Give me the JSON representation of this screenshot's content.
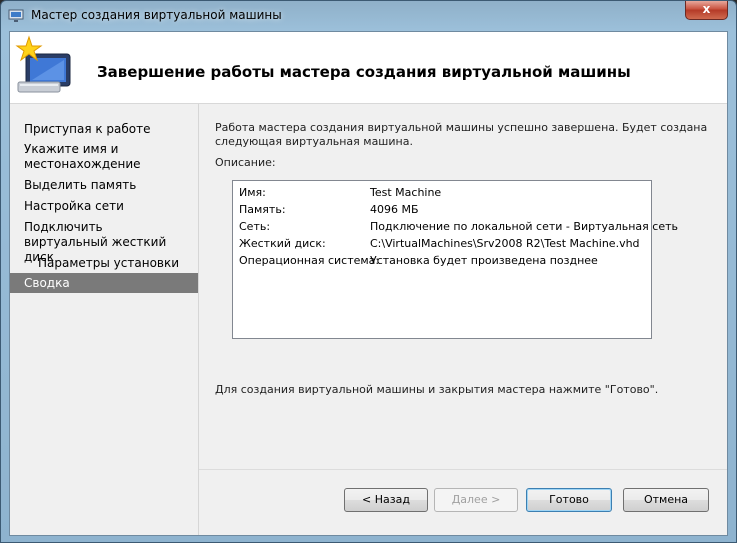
{
  "window": {
    "title": "Мастер создания виртуальной машины",
    "close_glyph": "x"
  },
  "header": {
    "title": "Завершение работы мастера создания виртуальной машины",
    "icon": "wizard-monitor-star-icon"
  },
  "nav": {
    "items": [
      {
        "label": "Приступая к работе"
      },
      {
        "label": "Укажите имя и местонахождение"
      },
      {
        "label": "Выделить память"
      },
      {
        "label": "Настройка сети"
      },
      {
        "label": "Подключить виртуальный жесткий диск"
      },
      {
        "label": "Параметры установки"
      },
      {
        "label": "Сводка"
      }
    ],
    "active_index": 6
  },
  "content": {
    "intro": "Работа мастера создания виртуальной машины успешно завершена. Будет создана следующая виртуальная машина.",
    "description_label": "Описание:",
    "summary": [
      {
        "key": "Имя:",
        "value": "Test Machine"
      },
      {
        "key": "Память:",
        "value": "4096 МБ"
      },
      {
        "key": "Сеть:",
        "value": "Подключение по локальной сети - Виртуальная сеть"
      },
      {
        "key": "Жесткий диск:",
        "value": "C:\\VirtualMachines\\Srv2008 R2\\Test Machine.vhd"
      },
      {
        "key": "Операционная система:",
        "value": "Установка будет произведена позднее"
      }
    ],
    "finish_note": "Для создания виртуальной машины и закрытия мастера нажмите \"Готово\"."
  },
  "buttons": {
    "back": "< Назад",
    "next": "Далее >",
    "finish": "Готово",
    "cancel": "Отмена"
  },
  "colors": {
    "active_nav_bg": "#7a7a7a",
    "close_button": "#c9523f"
  }
}
